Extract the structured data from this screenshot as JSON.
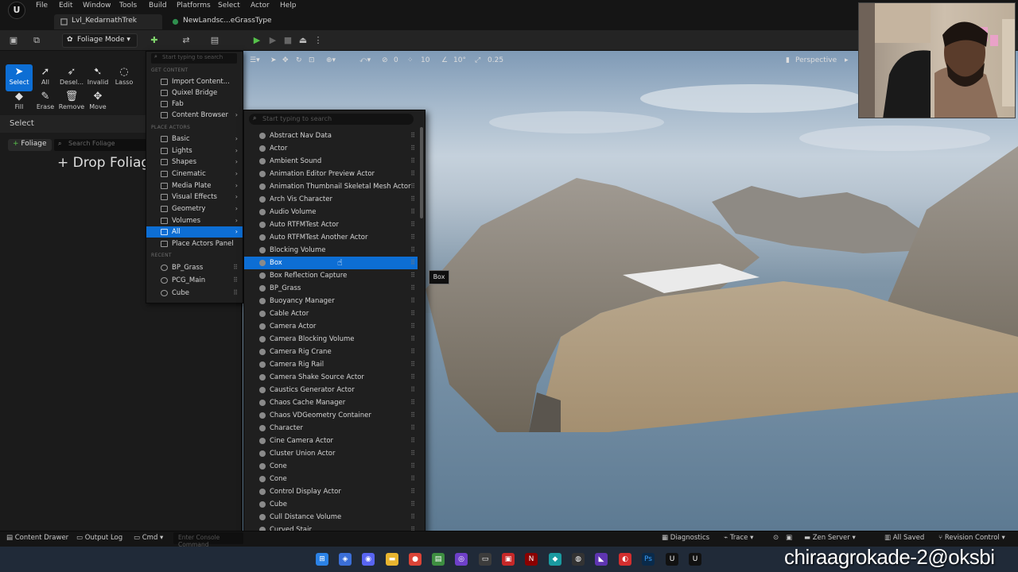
{
  "menubar": {
    "logo": "U",
    "items": [
      "File",
      "Edit",
      "Window",
      "Tools",
      "Build",
      "Platforms",
      "Select",
      "Actor",
      "Help"
    ]
  },
  "tabs": [
    {
      "label": "Lvl_KedarnathTrek"
    },
    {
      "label": "NewLandsc...eGrassType"
    }
  ],
  "toolbar": {
    "mode": "Foliage Mode ▾"
  },
  "foliage_tools": {
    "row1": [
      "Select",
      "All",
      "Desel...",
      "Invalid",
      "Lasso"
    ],
    "row2": [
      "Fill",
      "Erase",
      "Remove",
      "Move"
    ],
    "section_title": "Select",
    "add_button": "Foliage",
    "search_placeholder": "Search Foliage",
    "drop_text": "+ Drop Foliage"
  },
  "viewport": {
    "snap_rotation": "10°",
    "snap_grid": "10",
    "snap_scale": "0.25",
    "move_count": "0",
    "view_mode": "Perspective"
  },
  "add_menu": {
    "search_placeholder": "Start typing to search",
    "get_content_header": "GET CONTENT",
    "get_content": [
      {
        "label": "Import Content...",
        "arrow": ""
      },
      {
        "label": "Quixel Bridge",
        "arrow": ""
      },
      {
        "label": "Fab",
        "arrow": ""
      },
      {
        "label": "Content Browser",
        "arrow": "›"
      }
    ],
    "place_actors_header": "PLACE ACTORS",
    "place_actors": [
      {
        "label": "Basic",
        "arrow": "›"
      },
      {
        "label": "Lights",
        "arrow": "›"
      },
      {
        "label": "Shapes",
        "arrow": "›"
      },
      {
        "label": "Cinematic",
        "arrow": "›"
      },
      {
        "label": "Media Plate",
        "arrow": "›"
      },
      {
        "label": "Visual Effects",
        "arrow": "›"
      },
      {
        "label": "Geometry",
        "arrow": "›"
      },
      {
        "label": "Volumes",
        "arrow": "›"
      },
      {
        "label": "All",
        "arrow": "›"
      },
      {
        "label": "Place Actors Panel",
        "arrow": ""
      }
    ],
    "recent_header": "RECENT",
    "recent": [
      "BP_Grass",
      "PCG_Main",
      "Cube"
    ],
    "active_item": "All"
  },
  "submenu": {
    "search_placeholder": "Start typing to search",
    "items": [
      "Abstract Nav Data",
      "Actor",
      "Ambient Sound",
      "Animation Editor Preview Actor",
      "Animation Thumbnail Skeletal Mesh Actor",
      "Arch Vis Character",
      "Audio Volume",
      "Auto RTFMTest Actor",
      "Auto RTFMTest Another Actor",
      "Blocking Volume",
      "Box",
      "Box Reflection Capture",
      "BP_Grass",
      "Buoyancy Manager",
      "Cable Actor",
      "Camera Actor",
      "Camera Blocking Volume",
      "Camera Rig Crane",
      "Camera Rig Rail",
      "Camera Shake Source Actor",
      "Caustics Generator Actor",
      "Chaos Cache Manager",
      "Chaos VDGeometry Container",
      "Character",
      "Cine Camera Actor",
      "Cluster Union Actor",
      "Cone",
      "Cone",
      "Control Display Actor",
      "Cube",
      "Cull Distance Volume",
      "Curved Stair"
    ],
    "highlighted": "Box",
    "tooltip": "Box"
  },
  "statusbar": {
    "content_drawer": "Content Drawer",
    "output_log": "Output Log",
    "cmd": "Cmd",
    "console_placeholder": "Enter Console Command",
    "diagnostics": "Diagnostics",
    "trace": "Trace",
    "zen_server": "Zen Server",
    "all_saved": "All Saved",
    "revision_control": "Revision Control"
  },
  "watermark": "chiraagrokade-2@oksbi",
  "colors": {
    "accent": "#0d6ed4",
    "panel": "#1b1b1b",
    "menu": "#1f1f1f",
    "taskbar": "#202a38"
  }
}
